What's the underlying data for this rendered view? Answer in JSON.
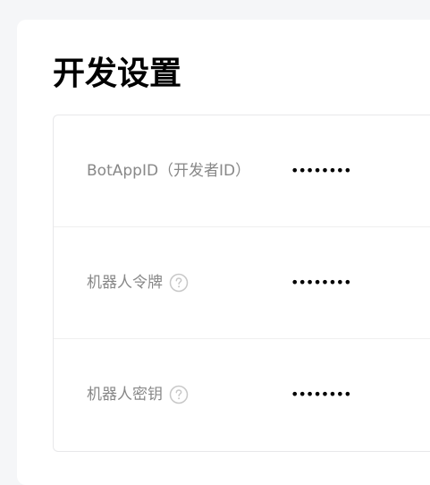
{
  "page": {
    "title": "开发设置"
  },
  "settings": [
    {
      "label": "BotAppID（开发者ID）",
      "value": "••••••••",
      "help_icon": false
    },
    {
      "label": "机器人令牌",
      "value": "••••••••",
      "help_icon": true,
      "icon": "question-circle-icon"
    },
    {
      "label": "机器人密钥",
      "value": "••••••••",
      "help_icon": true,
      "icon": "question-circle-icon"
    }
  ],
  "colors": {
    "background": "#f5f6f8",
    "card": "#ffffff",
    "label": "#888888",
    "value": "#000000",
    "border": "#e8e8ea"
  }
}
